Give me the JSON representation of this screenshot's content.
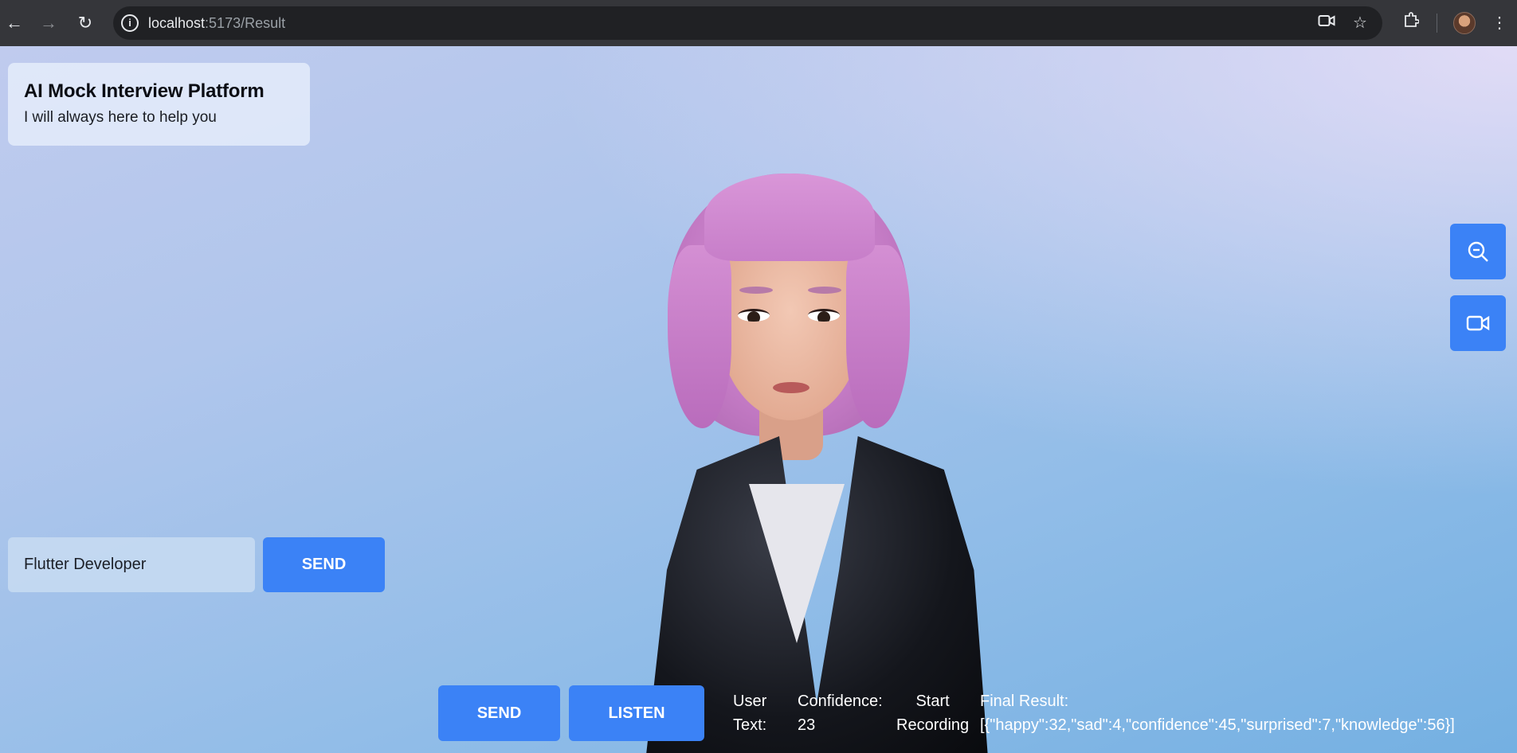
{
  "browser": {
    "url_host": "localhost",
    "url_path": ":5173/Result",
    "icons": [
      "back-icon",
      "forward-icon",
      "reload-icon",
      "site-info-icon",
      "camera-icon",
      "star-icon",
      "extensions-icon",
      "menu-icon"
    ]
  },
  "header": {
    "title": "AI Mock Interview Platform",
    "subtitle": "I will always here to help you"
  },
  "side_controls": {
    "icons": [
      "zoom-out-icon",
      "video-camera-icon"
    ]
  },
  "job_form": {
    "input_value": "Flutter Developer",
    "send_label": "SEND"
  },
  "bottom_bar": {
    "send_label": "SEND",
    "listen_label": "LISTEN",
    "user_text_label_1": "User",
    "user_text_label_2": "Text:",
    "user_text_value": "",
    "confidence_label": "Confidence:",
    "confidence_value": "23",
    "recording_label_1": "Start",
    "recording_label_2": "Recording",
    "final_result_label": "Final Result:",
    "final_result_value": "[{\"happy\":32,\"sad\":4,\"confidence\":45,\"surprised\":7,\"knowledge\":56}]"
  },
  "colors": {
    "accent": "#3b82f6",
    "chrome_bg": "#35363a",
    "omnibox_bg": "#202124"
  }
}
